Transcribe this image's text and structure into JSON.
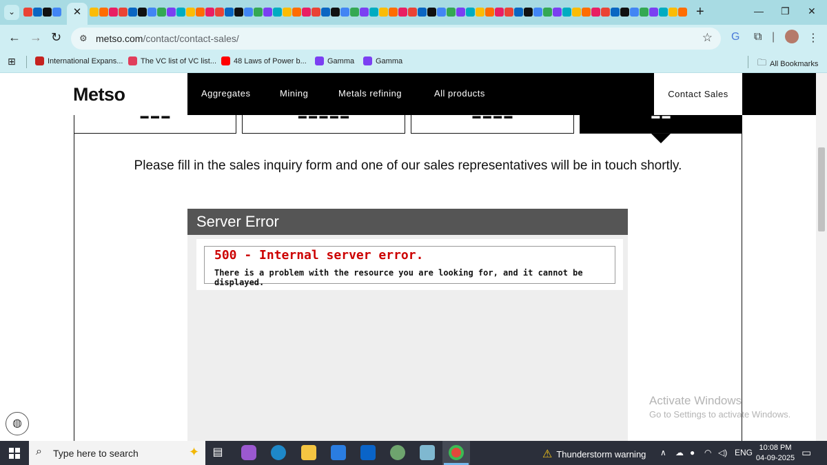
{
  "browser": {
    "active_tab_close": "✕",
    "tab_dropdown": "⌄",
    "new_tab": "+",
    "url_domain": "metso.com",
    "url_path": "/contact/contact-sales/",
    "window_controls": [
      "—",
      "❐",
      "✕"
    ],
    "bookmarks": [
      {
        "label": "International Expans...",
        "icon": "gmail-icon",
        "color": "#c5221f"
      },
      {
        "label": "The VC list of VC list...",
        "icon": "notion-icon",
        "color": "#e03e5c"
      },
      {
        "label": "48 Laws of Power b...",
        "icon": "youtube-icon",
        "color": "#ff0000"
      },
      {
        "label": "Gamma",
        "icon": "gamma-icon",
        "color": "#7b3ff2"
      },
      {
        "label": "Gamma",
        "icon": "gamma-icon",
        "color": "#7b3ff2"
      }
    ],
    "all_bookmarks": "All Bookmarks"
  },
  "site": {
    "logo": "Metso",
    "nav": [
      "Aggregates",
      "Mining",
      "Metals refining",
      "All products"
    ],
    "contact_sales": "Contact Sales",
    "lead_text": "Please fill in the sales inquiry form and one of our sales representatives will be in touch shortly."
  },
  "error": {
    "title": "Server Error",
    "code": "500 - Internal server error.",
    "message": "There is a problem with the resource you are looking for, and it cannot be displayed."
  },
  "watermark": {
    "line1": "Activate Windows",
    "line2": "Go to Settings to activate Windows."
  },
  "taskbar": {
    "search_placeholder": "Type here to search",
    "weather": "Thunderstorm warning",
    "language": "ENG",
    "time": "10:08 PM",
    "date": "04-09-2025"
  },
  "colors": {
    "accent": "#000000",
    "error_red": "#cc0000",
    "error_header": "#555555",
    "chrome_tabstrip": "#a8dbe3"
  }
}
